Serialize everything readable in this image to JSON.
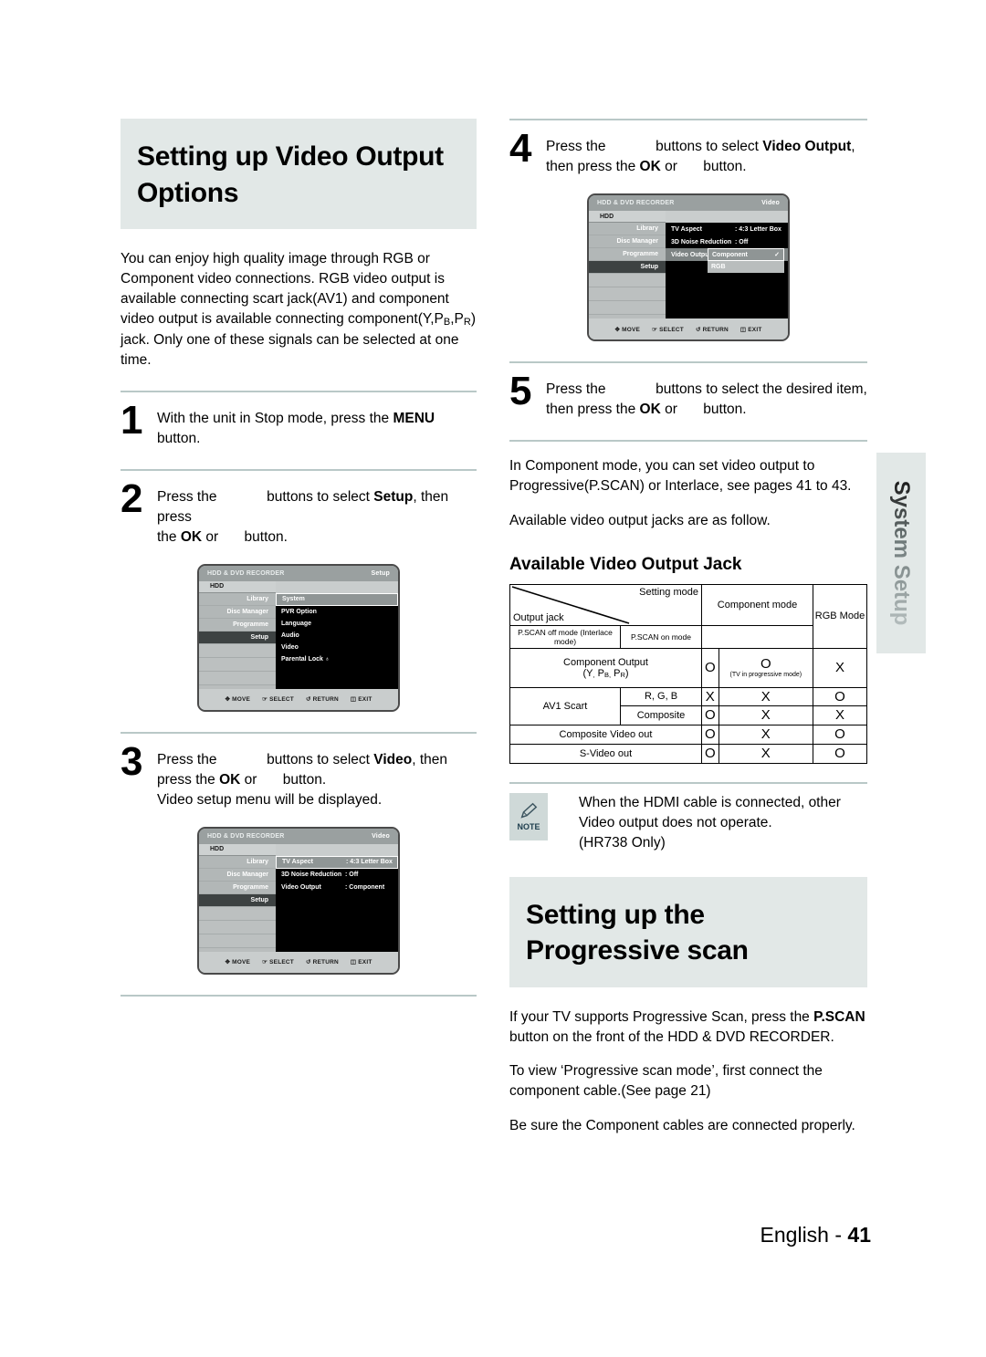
{
  "left": {
    "banner_title": "Setting up Video Output Options",
    "intro_part1": "You can enjoy high quality image through RGB or Component video connections. RGB video output is available connecting scart jack(AV1) and component video output is available connecting component(Y,P",
    "intro_sub_b": "B",
    "intro_part2": ",P",
    "intro_sub_r": "R",
    "intro_part3": ") jack. Only one of these signals can be selected at one time.",
    "steps": [
      {
        "num": "1",
        "line1_a": "With the unit in Stop mode, press the ",
        "line1_bold": "MENU",
        "line1_b": "",
        "line2_a": "button.",
        "line2_bold": "",
        "line2_b": ""
      },
      {
        "num": "2",
        "line1_a": "Press the ",
        "line1_gap": true,
        "line1_mid": " buttons to select ",
        "line1_bold": "Setup",
        "line1_end": ", then press",
        "line2_a": "the ",
        "line2_bold": "OK",
        "line2_mid": " or ",
        "line2_end": "button."
      },
      {
        "num": "3",
        "line1_a": "Press the ",
        "line1_mid": " buttons to select ",
        "line1_bold": "Video",
        "line1_end": ", then",
        "line2_a": "press the ",
        "line2_bold": "OK",
        "line2_mid": " or ",
        "line2_end": "button.",
        "line3": "Video setup menu will be displayed."
      }
    ],
    "osd_setup": {
      "title": "HDD & DVD RECORDER",
      "mode": "Setup",
      "hdd_label": "HDD",
      "nav": [
        "Library",
        "Disc Manager",
        "Programme",
        "Setup"
      ],
      "nav_selected": "Setup",
      "items": [
        "System",
        "PVR Option",
        "Language",
        "Audio",
        "Video",
        "Parental Lock ♁"
      ],
      "item_selected": "System",
      "bottom": [
        "MOVE",
        "SELECT",
        "RETURN",
        "EXIT"
      ]
    },
    "osd_video": {
      "title": "HDD & DVD RECORDER",
      "mode": "Video",
      "hdd_label": "HDD",
      "nav": [
        "Library",
        "Disc Manager",
        "Programme",
        "Setup"
      ],
      "nav_selected": "Setup",
      "rows": [
        {
          "key": "TV Aspect",
          "value": ": 4:3 Letter Box",
          "selected": true
        },
        {
          "key": "3D Noise Reduction",
          "value": ": Off",
          "selected": false
        },
        {
          "key": "Video Output",
          "value": ": Component",
          "selected": false
        }
      ],
      "bottom": [
        "MOVE",
        "SELECT",
        "RETURN",
        "EXIT"
      ]
    }
  },
  "right": {
    "steps": [
      {
        "num": "4",
        "line1_a": "Press the ",
        "line1_mid": " buttons to select ",
        "line1_bold": "Video Output",
        "line1_end": ",",
        "line2_a": "then press the ",
        "line2_bold": "OK",
        "line2_mid": " or ",
        "line2_end": "button."
      },
      {
        "num": "5",
        "line1_a": "Press the ",
        "line1_mid": " buttons to select the desired item,",
        "line1_bold": "",
        "line1_end": "",
        "line2_a": "then press the ",
        "line2_bold": "OK",
        "line2_mid": " or ",
        "line2_end": "button."
      }
    ],
    "osd_dropdown": {
      "title": "HDD & DVD RECORDER",
      "mode": "Video",
      "hdd_label": "HDD",
      "nav": [
        "Library",
        "Disc Manager",
        "Programme",
        "Setup"
      ],
      "nav_selected": "Setup",
      "rows": [
        {
          "key": "TV Aspect",
          "value": ": 4:3 Letter Box"
        },
        {
          "key": "3D Noise Reduction",
          "value": ": Off"
        },
        {
          "key": "Video Output",
          "value": ""
        }
      ],
      "dropdown_options": [
        "Component",
        "RGB"
      ],
      "dropdown_selected": "Component",
      "check_glyph": "✓",
      "bottom": [
        "MOVE",
        "SELECT",
        "RETURN",
        "EXIT"
      ]
    },
    "paragraph1": "In Component mode, you can set video output to Progressive(P.SCAN) or Interlace, see pages 41 to 43.",
    "paragraph2": "Available video output jacks are as follow.",
    "jack_heading": "Available Video Output Jack",
    "note": {
      "badge_label": "NOTE",
      "icon": "pencil-icon",
      "line1": "When the HDMI cable is connected, other",
      "line2": "Video output does not operate.",
      "line3": "(HR738 Only)"
    },
    "banner2_title": "Setting up the Progressive scan",
    "prog_para1_a": "If your TV supports Progressive Scan, press the ",
    "prog_para1_bold": "P.SCAN",
    "prog_para1_b": " button on the front of the HDD & DVD RECORDER.",
    "prog_para2": "To view ‘Progressive scan mode’, first connect the component cable.(See page 21)",
    "prog_para3": "Be sure the Component cables are connected properly."
  },
  "side_tab": {
    "label": "System Setup"
  },
  "footer": {
    "language": "English - ",
    "page": "41"
  },
  "table_data": {
    "type": "table",
    "corner_top": "Setting mode",
    "corner_bottom": "Output jack",
    "group_header": "Component mode",
    "rgb_header": "RGB Mode",
    "columns": [
      "P.SCAN off mode (Interlace mode)",
      "P.SCAN on mode",
      "RGB Mode"
    ],
    "rows": [
      {
        "label": "Component Output",
        "label_sub": "(Y, PB, PR)",
        "values": [
          "O",
          "O",
          "X"
        ],
        "note_on_col2": "(TV in progressive mode)"
      },
      {
        "group": "AV1 Scart",
        "label": "R, G, B",
        "values": [
          "X",
          "X",
          "O"
        ]
      },
      {
        "group": "AV1 Scart",
        "label": "Composite",
        "values": [
          "O",
          "X",
          "X"
        ]
      },
      {
        "label": "Composite Video out",
        "values": [
          "O",
          "X",
          "O"
        ]
      },
      {
        "label": "S-Video out",
        "values": [
          "O",
          "X",
          "O"
        ]
      }
    ]
  },
  "colors": {
    "banner_bg": "#e2e8e7",
    "rule": "#b9c8c7",
    "note_badge_bg": "#cfd9d8",
    "osd_frame": "#4a4a4a"
  }
}
